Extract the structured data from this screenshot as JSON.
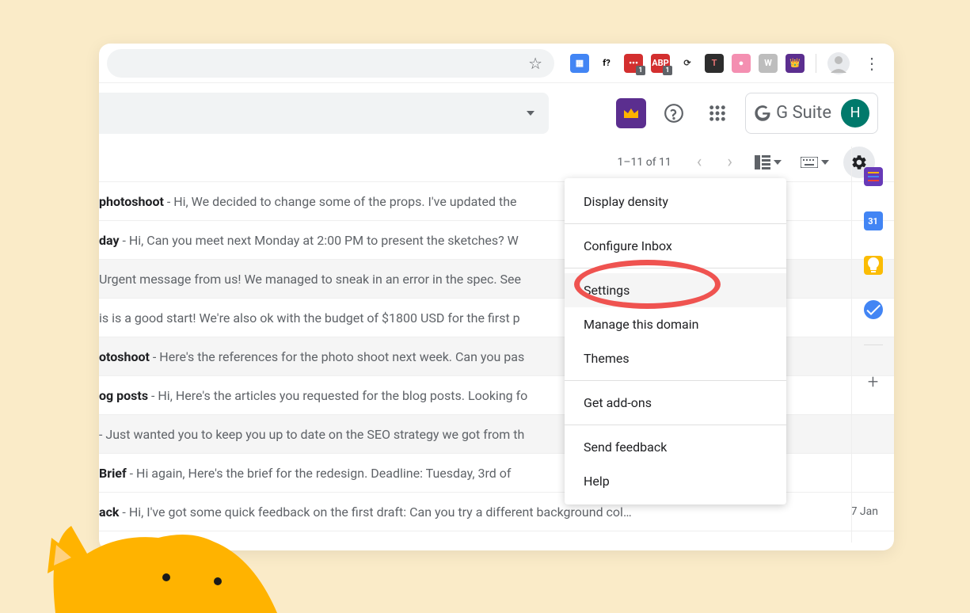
{
  "chrome": {
    "extensions": [
      {
        "name": "translate-icon",
        "bg": "#4285f4",
        "glyph": "▦"
      },
      {
        "name": "font-icon",
        "bg": "transparent",
        "glyph": "f?",
        "color": "#000"
      },
      {
        "name": "lastpass-icon",
        "bg": "#d32f2f",
        "glyph": "•••",
        "badge": "1"
      },
      {
        "name": "adblock-icon",
        "bg": "#d32f2f",
        "glyph": "ABP",
        "badge": "1"
      },
      {
        "name": "sync-icon",
        "bg": "transparent",
        "glyph": "⟳",
        "color": "#333"
      },
      {
        "name": "toggl-icon",
        "bg": "#2d2d2d",
        "glyph": "T",
        "color": "#e57373"
      },
      {
        "name": "pink-icon",
        "bg": "#f48fb1",
        "glyph": "●"
      },
      {
        "name": "wave-icon",
        "bg": "#bdbdbd",
        "glyph": "W"
      },
      {
        "name": "crown-ext-icon",
        "bg": "#5b2e8f",
        "glyph": "👑"
      }
    ]
  },
  "header": {
    "gsuite_label": "G Suite",
    "avatar_letter": "H"
  },
  "toolbar": {
    "pagination": "1–11 of 11"
  },
  "dropdown": {
    "items": [
      {
        "label": "Display density",
        "divider_after": true
      },
      {
        "label": "Configure Inbox",
        "divider_after": true
      },
      {
        "label": "Settings",
        "highlighted": true
      },
      {
        "label": "Manage this domain"
      },
      {
        "label": "Themes",
        "divider_after": true
      },
      {
        "label": "Get add-ons",
        "divider_after": true
      },
      {
        "label": "Send feedback"
      },
      {
        "label": "Help"
      }
    ]
  },
  "emails": [
    {
      "subject": "photoshoot",
      "snippet": " - Hi, We decided to change some of the props. I've updated the"
    },
    {
      "subject": "day",
      "snippet": " - Hi, Can you meet next Monday at 2:00 PM to present the sketches? W"
    },
    {
      "subject": "",
      "snippet": "Urgent message from us! We managed to sneak in an error in the spec. See ",
      "shaded": true
    },
    {
      "subject": "",
      "snippet": "is is a good start! We're also ok with the budget of $1800 USD for the first p"
    },
    {
      "subject": "otoshoot",
      "snippet": " - Here's the references for the photo shoot next week. Can you pas",
      "shaded": true
    },
    {
      "subject": "og posts",
      "snippet": " - Hi, Here's the articles you requested for the blog posts. Looking fo"
    },
    {
      "subject": "",
      "snippet": "- Just wanted you to keep you up to date on the SEO strategy we got from th",
      "shaded": true
    },
    {
      "subject": "Brief",
      "snippet": " - Hi again, Here's the brief for the redesign. Deadline: Tuesday, 3rd of "
    },
    {
      "subject": "ack",
      "snippet": " - Hi, I've got some quick feedback on the first draft: Can you try a different background col…",
      "date": "7 Jan"
    }
  ],
  "sidebar": {
    "calendar_day": "31"
  }
}
